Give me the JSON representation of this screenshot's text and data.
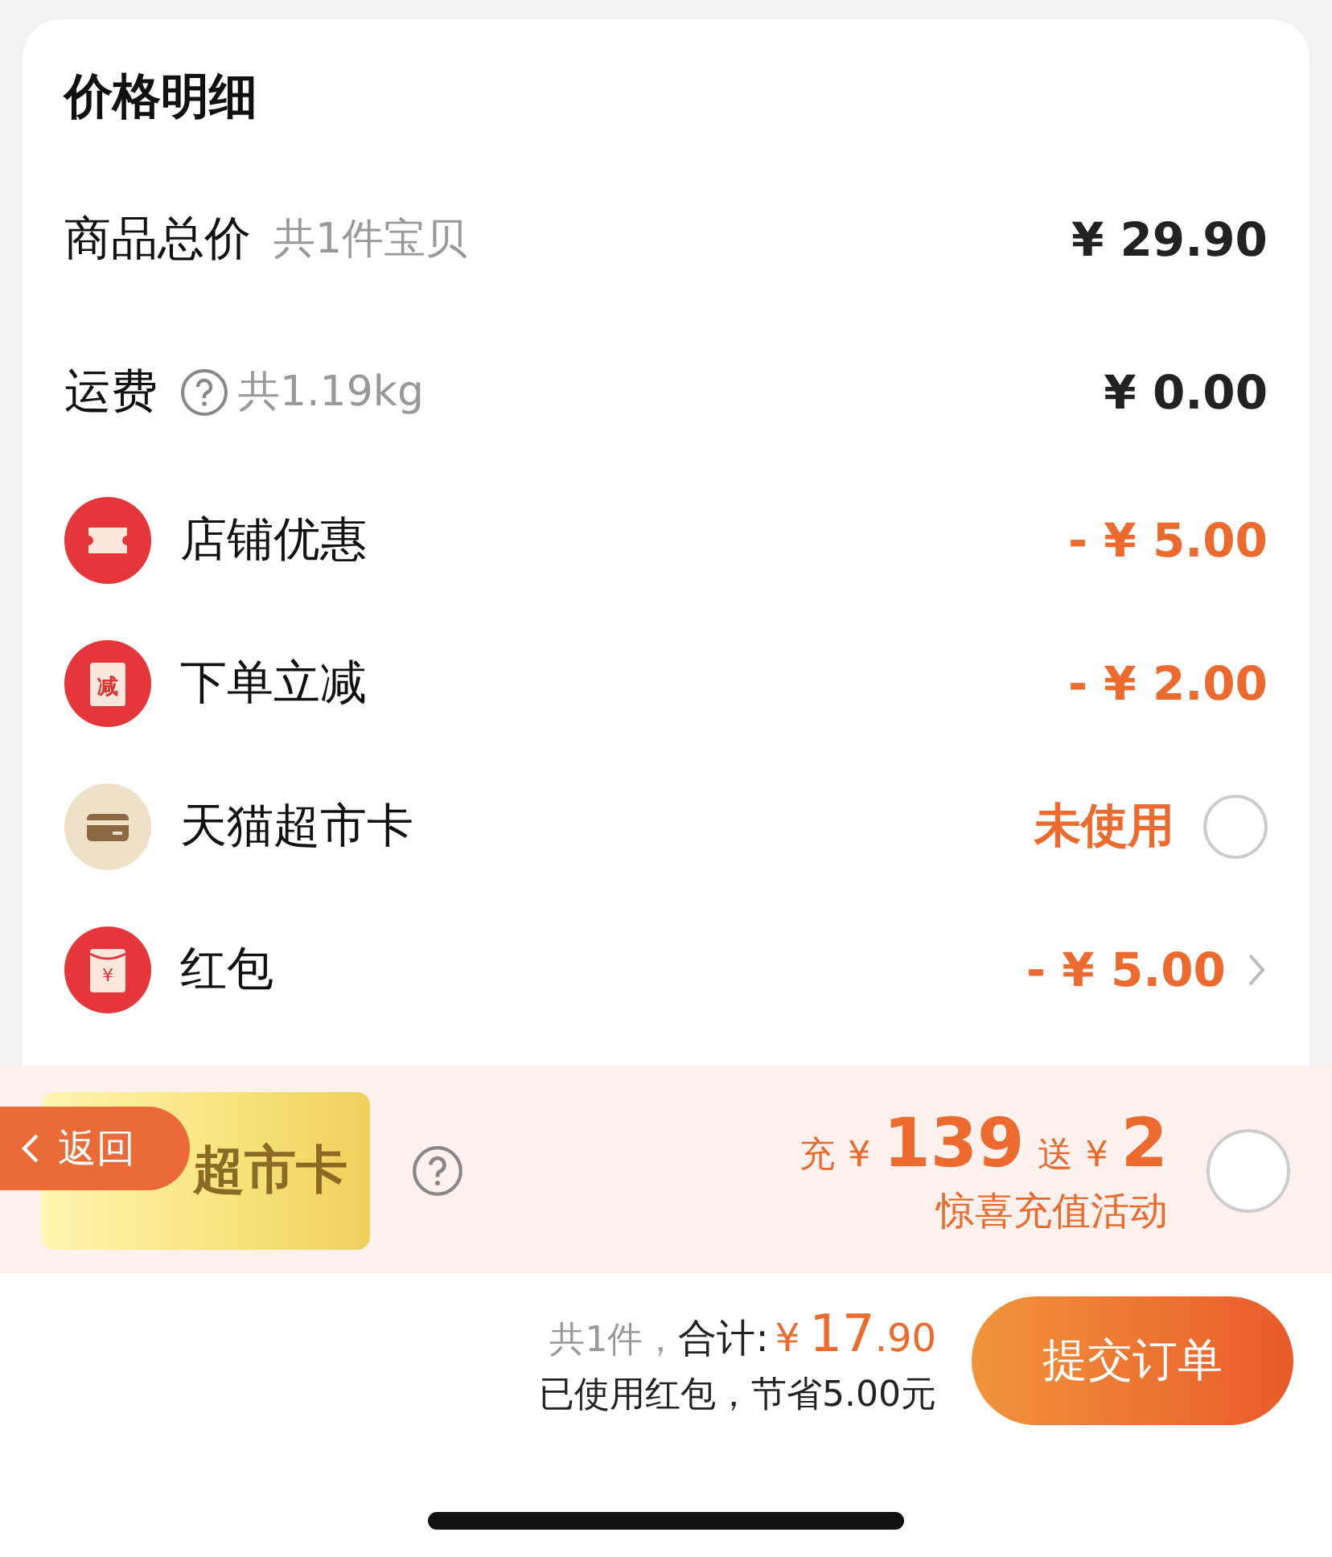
{
  "title": "价格明细",
  "rows": [
    {
      "kind": "plain",
      "label": "商品总价",
      "note": "共1件宝贝",
      "value": "¥ 29.90"
    },
    {
      "kind": "plain",
      "label": "运费",
      "help": true,
      "note": "共1.19kg",
      "value": "¥ 0.00"
    },
    {
      "kind": "ticket",
      "label": "店铺优惠",
      "value": "- ¥ 5.00"
    },
    {
      "kind": "instant",
      "icon_text": "减",
      "label": "下单立减",
      "value": "- ¥ 2.00"
    },
    {
      "kind": "card",
      "label": "天猫超市卡",
      "value": "未使用",
      "checked": false
    },
    {
      "kind": "envelope",
      "icon_text": "¥",
      "label": "红包",
      "value": "- ¥ 5.00"
    }
  ],
  "banner": {
    "card_label": "超市卡",
    "back": "返回",
    "help": true,
    "recharge_word": "充",
    "currency_1": "¥",
    "recharge_amount": "139",
    "bonus_word": "送",
    "currency_2": "¥",
    "bonus_amount": "2",
    "subtitle": "惊喜充值活动",
    "checked": false
  },
  "footer": {
    "count": "共1件，",
    "total_label": "合计:",
    "currency": "¥",
    "amount_int": "17",
    "amount_dec": ".90",
    "savings": "已使用红包，节省5.00元",
    "submit": "提交订单"
  }
}
